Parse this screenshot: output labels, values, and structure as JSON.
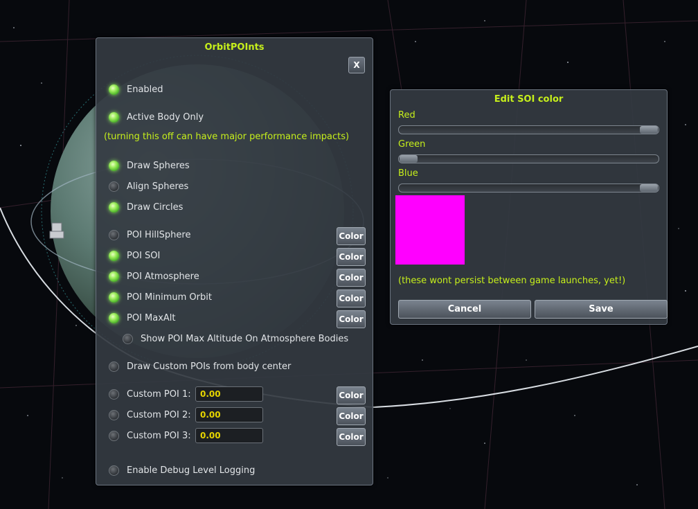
{
  "main_window": {
    "title": "OrbitPOInts",
    "close_label": "X",
    "toggles": {
      "enabled": {
        "label": "Enabled",
        "on": true
      },
      "active_body_only": {
        "label": "Active Body Only",
        "on": true
      },
      "draw_spheres": {
        "label": "Draw Spheres",
        "on": true
      },
      "align_spheres": {
        "label": "Align Spheres",
        "on": false
      },
      "draw_circles": {
        "label": "Draw Circles",
        "on": true
      },
      "poi_hillsphere": {
        "label": "POI HillSphere",
        "on": false
      },
      "poi_soi": {
        "label": "POI SOI",
        "on": true
      },
      "poi_atmosphere": {
        "label": "POI Atmosphere",
        "on": true
      },
      "poi_minimum_orbit": {
        "label": "POI Minimum Orbit",
        "on": true
      },
      "poi_maxalt": {
        "label": "POI MaxAlt",
        "on": true
      },
      "show_poi_max_altitude": {
        "label": "Show POI Max Altitude On Atmosphere Bodies",
        "on": false
      },
      "draw_custom_pois": {
        "label": "Draw Custom POIs from body center",
        "on": false
      },
      "custom_poi_1": {
        "label": "Custom POI 1:",
        "on": false
      },
      "custom_poi_2": {
        "label": "Custom POI 2:",
        "on": false
      },
      "custom_poi_3": {
        "label": "Custom POI 3:",
        "on": false
      },
      "debug_logging": {
        "label": "Enable Debug Level Logging",
        "on": false
      }
    },
    "performance_note": "(turning this off can have major performance impacts)",
    "color_button_label": "Color",
    "custom_poi_values": [
      "0.00",
      "0.00",
      "0.00"
    ]
  },
  "soi_window": {
    "title": "Edit SOI color",
    "sliders": [
      {
        "label": "Red",
        "value": 1.0
      },
      {
        "label": "Green",
        "value": 0.0
      },
      {
        "label": "Blue",
        "value": 1.0
      }
    ],
    "swatch_color": "#ff00ff",
    "persist_note": "(these wont persist between game launches, yet!)",
    "cancel_label": "Cancel",
    "save_label": "Save"
  },
  "colors": {
    "accent": "#c6ef1b",
    "led_on": "#8de65a",
    "value_text": "#e6d500"
  }
}
